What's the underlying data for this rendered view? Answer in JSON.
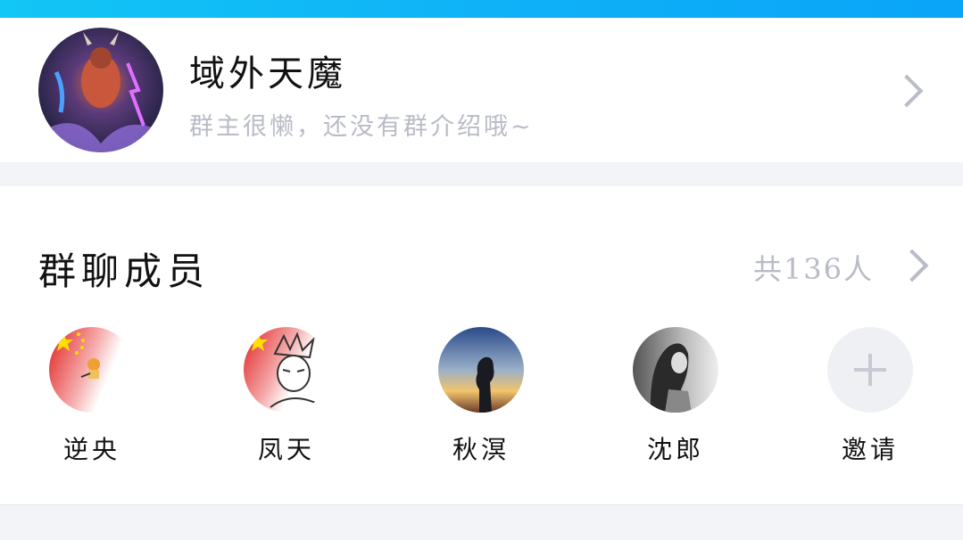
{
  "status_bar": {
    "color": "#0fb2f7"
  },
  "group": {
    "name": "域外天魔",
    "description": "群主很懒，还没有群介绍哦~",
    "avatar_icon": "demon-warrior-avatar"
  },
  "members_section": {
    "title": "群聊成员",
    "count_text": "共136人",
    "members": [
      {
        "name": "逆央",
        "avatar_icon": "china-flag-cat-avatar"
      },
      {
        "name": "凤天",
        "avatar_icon": "china-flag-anime-avatar"
      },
      {
        "name": "秋溟",
        "avatar_icon": "sunset-silhouette-avatar"
      },
      {
        "name": "沈郎",
        "avatar_icon": "grayscale-portrait-avatar"
      }
    ],
    "invite": {
      "label": "邀请",
      "icon": "plus-icon"
    }
  },
  "colors": {
    "title_text": "#111111",
    "secondary_text": "#b9bcc6",
    "background": "#f3f4f7",
    "card": "#ffffff"
  }
}
